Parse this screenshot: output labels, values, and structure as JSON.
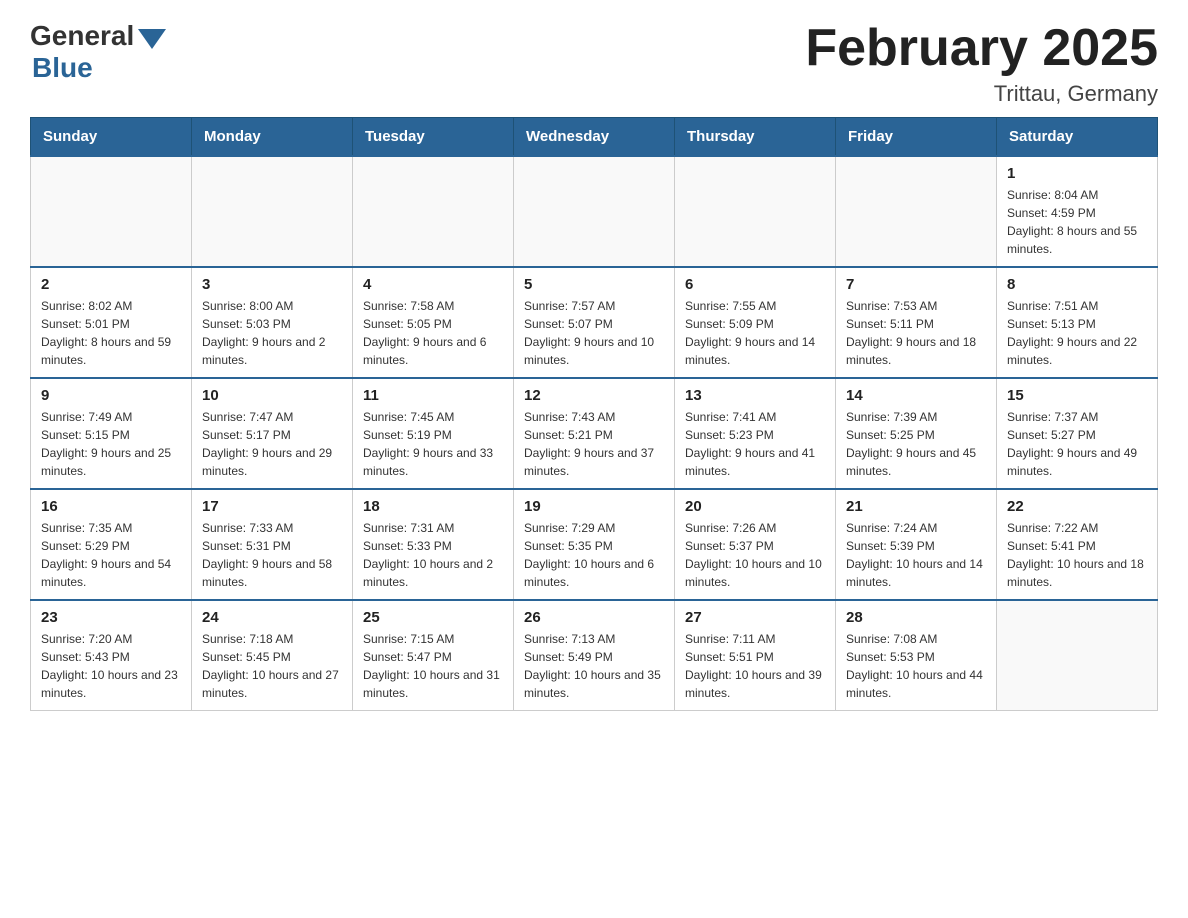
{
  "header": {
    "logo_general": "General",
    "logo_blue": "Blue",
    "month_title": "February 2025",
    "location": "Trittau, Germany"
  },
  "days_of_week": [
    "Sunday",
    "Monday",
    "Tuesday",
    "Wednesday",
    "Thursday",
    "Friday",
    "Saturday"
  ],
  "weeks": [
    [
      {
        "day": "",
        "info": ""
      },
      {
        "day": "",
        "info": ""
      },
      {
        "day": "",
        "info": ""
      },
      {
        "day": "",
        "info": ""
      },
      {
        "day": "",
        "info": ""
      },
      {
        "day": "",
        "info": ""
      },
      {
        "day": "1",
        "info": "Sunrise: 8:04 AM\nSunset: 4:59 PM\nDaylight: 8 hours and 55 minutes."
      }
    ],
    [
      {
        "day": "2",
        "info": "Sunrise: 8:02 AM\nSunset: 5:01 PM\nDaylight: 8 hours and 59 minutes."
      },
      {
        "day": "3",
        "info": "Sunrise: 8:00 AM\nSunset: 5:03 PM\nDaylight: 9 hours and 2 minutes."
      },
      {
        "day": "4",
        "info": "Sunrise: 7:58 AM\nSunset: 5:05 PM\nDaylight: 9 hours and 6 minutes."
      },
      {
        "day": "5",
        "info": "Sunrise: 7:57 AM\nSunset: 5:07 PM\nDaylight: 9 hours and 10 minutes."
      },
      {
        "day": "6",
        "info": "Sunrise: 7:55 AM\nSunset: 5:09 PM\nDaylight: 9 hours and 14 minutes."
      },
      {
        "day": "7",
        "info": "Sunrise: 7:53 AM\nSunset: 5:11 PM\nDaylight: 9 hours and 18 minutes."
      },
      {
        "day": "8",
        "info": "Sunrise: 7:51 AM\nSunset: 5:13 PM\nDaylight: 9 hours and 22 minutes."
      }
    ],
    [
      {
        "day": "9",
        "info": "Sunrise: 7:49 AM\nSunset: 5:15 PM\nDaylight: 9 hours and 25 minutes."
      },
      {
        "day": "10",
        "info": "Sunrise: 7:47 AM\nSunset: 5:17 PM\nDaylight: 9 hours and 29 minutes."
      },
      {
        "day": "11",
        "info": "Sunrise: 7:45 AM\nSunset: 5:19 PM\nDaylight: 9 hours and 33 minutes."
      },
      {
        "day": "12",
        "info": "Sunrise: 7:43 AM\nSunset: 5:21 PM\nDaylight: 9 hours and 37 minutes."
      },
      {
        "day": "13",
        "info": "Sunrise: 7:41 AM\nSunset: 5:23 PM\nDaylight: 9 hours and 41 minutes."
      },
      {
        "day": "14",
        "info": "Sunrise: 7:39 AM\nSunset: 5:25 PM\nDaylight: 9 hours and 45 minutes."
      },
      {
        "day": "15",
        "info": "Sunrise: 7:37 AM\nSunset: 5:27 PM\nDaylight: 9 hours and 49 minutes."
      }
    ],
    [
      {
        "day": "16",
        "info": "Sunrise: 7:35 AM\nSunset: 5:29 PM\nDaylight: 9 hours and 54 minutes."
      },
      {
        "day": "17",
        "info": "Sunrise: 7:33 AM\nSunset: 5:31 PM\nDaylight: 9 hours and 58 minutes."
      },
      {
        "day": "18",
        "info": "Sunrise: 7:31 AM\nSunset: 5:33 PM\nDaylight: 10 hours and 2 minutes."
      },
      {
        "day": "19",
        "info": "Sunrise: 7:29 AM\nSunset: 5:35 PM\nDaylight: 10 hours and 6 minutes."
      },
      {
        "day": "20",
        "info": "Sunrise: 7:26 AM\nSunset: 5:37 PM\nDaylight: 10 hours and 10 minutes."
      },
      {
        "day": "21",
        "info": "Sunrise: 7:24 AM\nSunset: 5:39 PM\nDaylight: 10 hours and 14 minutes."
      },
      {
        "day": "22",
        "info": "Sunrise: 7:22 AM\nSunset: 5:41 PM\nDaylight: 10 hours and 18 minutes."
      }
    ],
    [
      {
        "day": "23",
        "info": "Sunrise: 7:20 AM\nSunset: 5:43 PM\nDaylight: 10 hours and 23 minutes."
      },
      {
        "day": "24",
        "info": "Sunrise: 7:18 AM\nSunset: 5:45 PM\nDaylight: 10 hours and 27 minutes."
      },
      {
        "day": "25",
        "info": "Sunrise: 7:15 AM\nSunset: 5:47 PM\nDaylight: 10 hours and 31 minutes."
      },
      {
        "day": "26",
        "info": "Sunrise: 7:13 AM\nSunset: 5:49 PM\nDaylight: 10 hours and 35 minutes."
      },
      {
        "day": "27",
        "info": "Sunrise: 7:11 AM\nSunset: 5:51 PM\nDaylight: 10 hours and 39 minutes."
      },
      {
        "day": "28",
        "info": "Sunrise: 7:08 AM\nSunset: 5:53 PM\nDaylight: 10 hours and 44 minutes."
      },
      {
        "day": "",
        "info": ""
      }
    ]
  ]
}
